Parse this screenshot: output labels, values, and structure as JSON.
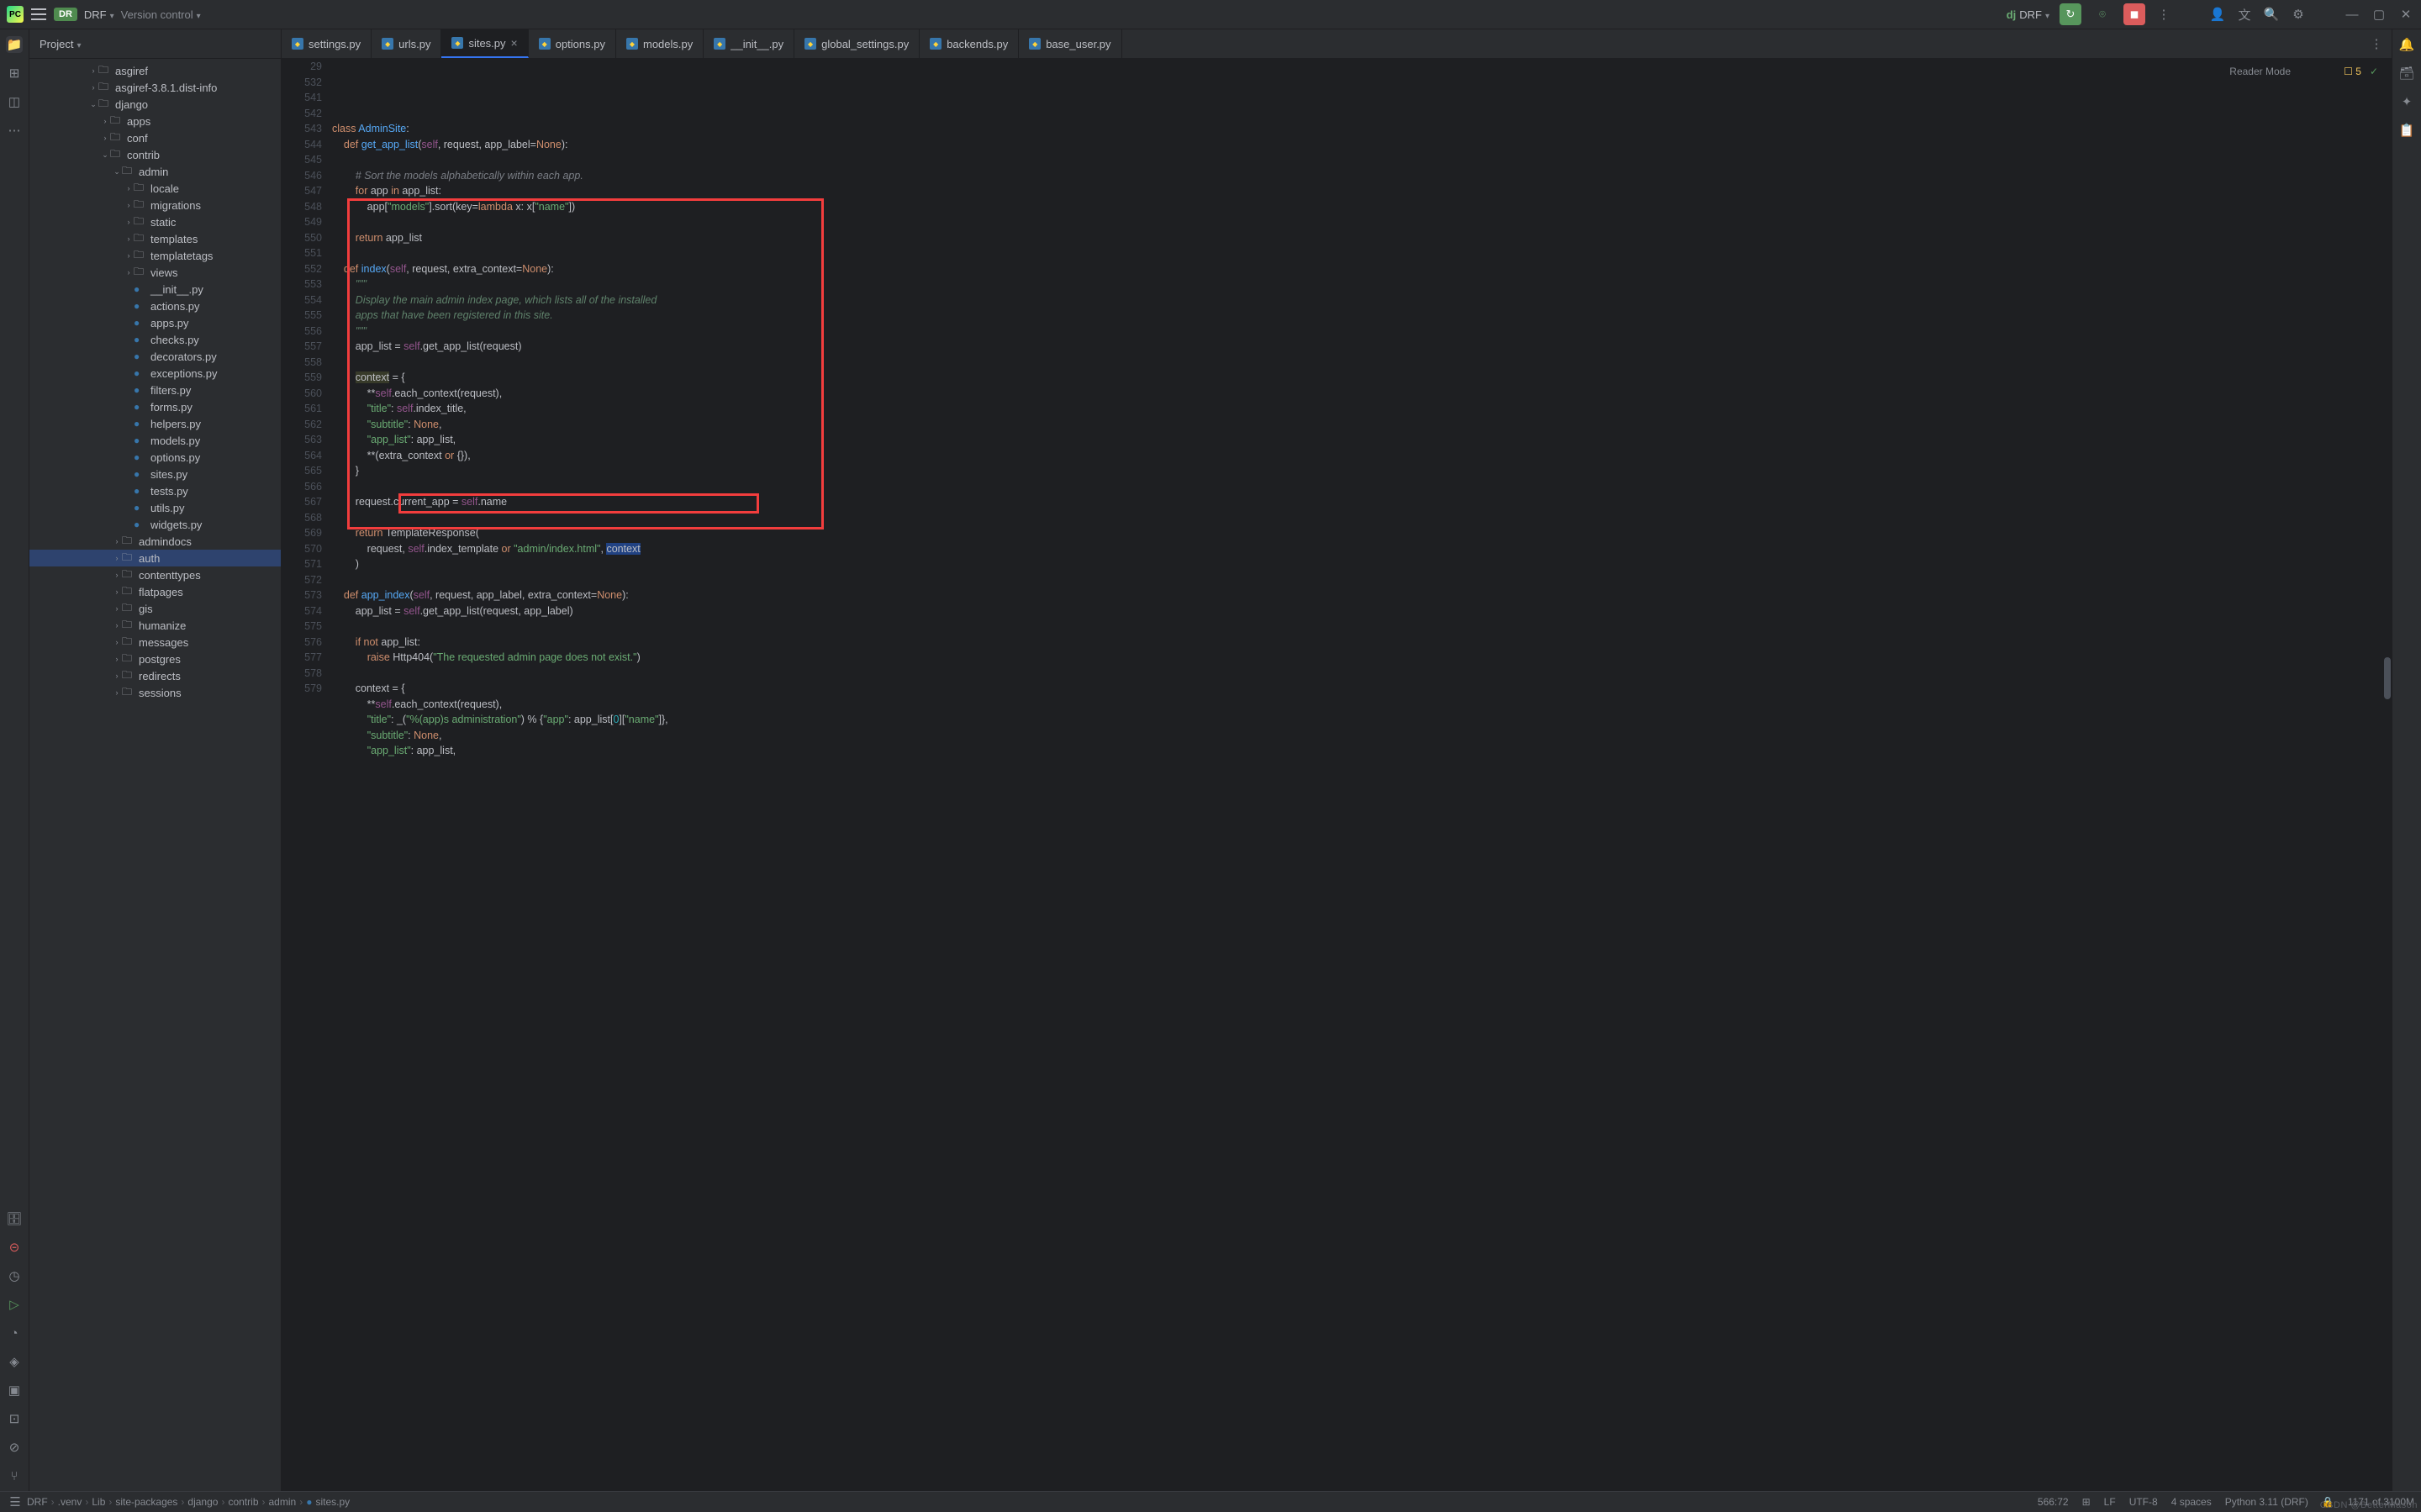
{
  "titlebar": {
    "project_badge": "DR",
    "project_name": "DRF",
    "vcs_label": "Version control",
    "run_config_icon": "dj",
    "run_config": "DRF"
  },
  "project_panel": {
    "header": "Project"
  },
  "tree": [
    {
      "indent": 5,
      "chevron": "›",
      "icon": "folder",
      "label": "asgiref"
    },
    {
      "indent": 5,
      "chevron": "›",
      "icon": "folder",
      "label": "asgiref-3.8.1.dist-info"
    },
    {
      "indent": 5,
      "chevron": "⌄",
      "icon": "folder",
      "label": "django"
    },
    {
      "indent": 6,
      "chevron": "›",
      "icon": "folder",
      "label": "apps"
    },
    {
      "indent": 6,
      "chevron": "›",
      "icon": "folder",
      "label": "conf"
    },
    {
      "indent": 6,
      "chevron": "⌄",
      "icon": "folder",
      "label": "contrib"
    },
    {
      "indent": 7,
      "chevron": "⌄",
      "icon": "folder",
      "label": "admin"
    },
    {
      "indent": 8,
      "chevron": "›",
      "icon": "folder",
      "label": "locale"
    },
    {
      "indent": 8,
      "chevron": "›",
      "icon": "folder",
      "label": "migrations"
    },
    {
      "indent": 8,
      "chevron": "›",
      "icon": "folder",
      "label": "static"
    },
    {
      "indent": 8,
      "chevron": "›",
      "icon": "folder",
      "label": "templates"
    },
    {
      "indent": 8,
      "chevron": "›",
      "icon": "folder",
      "label": "templatetags"
    },
    {
      "indent": 8,
      "chevron": "›",
      "icon": "folder",
      "label": "views"
    },
    {
      "indent": 8,
      "chevron": "",
      "icon": "py",
      "label": "__init__.py"
    },
    {
      "indent": 8,
      "chevron": "",
      "icon": "py",
      "label": "actions.py"
    },
    {
      "indent": 8,
      "chevron": "",
      "icon": "py",
      "label": "apps.py"
    },
    {
      "indent": 8,
      "chevron": "",
      "icon": "py",
      "label": "checks.py"
    },
    {
      "indent": 8,
      "chevron": "",
      "icon": "py",
      "label": "decorators.py"
    },
    {
      "indent": 8,
      "chevron": "",
      "icon": "py",
      "label": "exceptions.py"
    },
    {
      "indent": 8,
      "chevron": "",
      "icon": "py",
      "label": "filters.py"
    },
    {
      "indent": 8,
      "chevron": "",
      "icon": "py",
      "label": "forms.py"
    },
    {
      "indent": 8,
      "chevron": "",
      "icon": "py",
      "label": "helpers.py"
    },
    {
      "indent": 8,
      "chevron": "",
      "icon": "py",
      "label": "models.py"
    },
    {
      "indent": 8,
      "chevron": "",
      "icon": "py",
      "label": "options.py"
    },
    {
      "indent": 8,
      "chevron": "",
      "icon": "py",
      "label": "sites.py"
    },
    {
      "indent": 8,
      "chevron": "",
      "icon": "py",
      "label": "tests.py"
    },
    {
      "indent": 8,
      "chevron": "",
      "icon": "py",
      "label": "utils.py"
    },
    {
      "indent": 8,
      "chevron": "",
      "icon": "py",
      "label": "widgets.py"
    },
    {
      "indent": 7,
      "chevron": "›",
      "icon": "folder",
      "label": "admindocs"
    },
    {
      "indent": 7,
      "chevron": "›",
      "icon": "folder",
      "label": "auth",
      "selected": true
    },
    {
      "indent": 7,
      "chevron": "›",
      "icon": "folder",
      "label": "contenttypes"
    },
    {
      "indent": 7,
      "chevron": "›",
      "icon": "folder",
      "label": "flatpages"
    },
    {
      "indent": 7,
      "chevron": "›",
      "icon": "folder",
      "label": "gis"
    },
    {
      "indent": 7,
      "chevron": "›",
      "icon": "folder",
      "label": "humanize"
    },
    {
      "indent": 7,
      "chevron": "›",
      "icon": "folder",
      "label": "messages"
    },
    {
      "indent": 7,
      "chevron": "›",
      "icon": "folder",
      "label": "postgres"
    },
    {
      "indent": 7,
      "chevron": "›",
      "icon": "folder",
      "label": "redirects"
    },
    {
      "indent": 7,
      "chevron": "›",
      "icon": "folder",
      "label": "sessions"
    }
  ],
  "tabs": [
    {
      "label": "settings.py"
    },
    {
      "label": "urls.py"
    },
    {
      "label": "sites.py",
      "active": true
    },
    {
      "label": "options.py"
    },
    {
      "label": "models.py"
    },
    {
      "label": "__init__.py"
    },
    {
      "label": "global_settings.py"
    },
    {
      "label": "backends.py"
    },
    {
      "label": "base_user.py"
    }
  ],
  "reader_mode": "Reader Mode",
  "warnings": {
    "count": "5"
  },
  "breadcrumbs": [
    "DRF",
    ".venv",
    "Lib",
    "site-packages",
    "django",
    "contrib",
    "admin",
    "sites.py"
  ],
  "statusbar": {
    "cursor": "566:72",
    "line_sep": "LF",
    "encoding": "UTF-8",
    "indent": "4 spaces",
    "interpreter": "Python 3.11 (DRF)",
    "memory": "1171 of 3100M"
  },
  "watermark": "CSDN @BetterMason"
}
